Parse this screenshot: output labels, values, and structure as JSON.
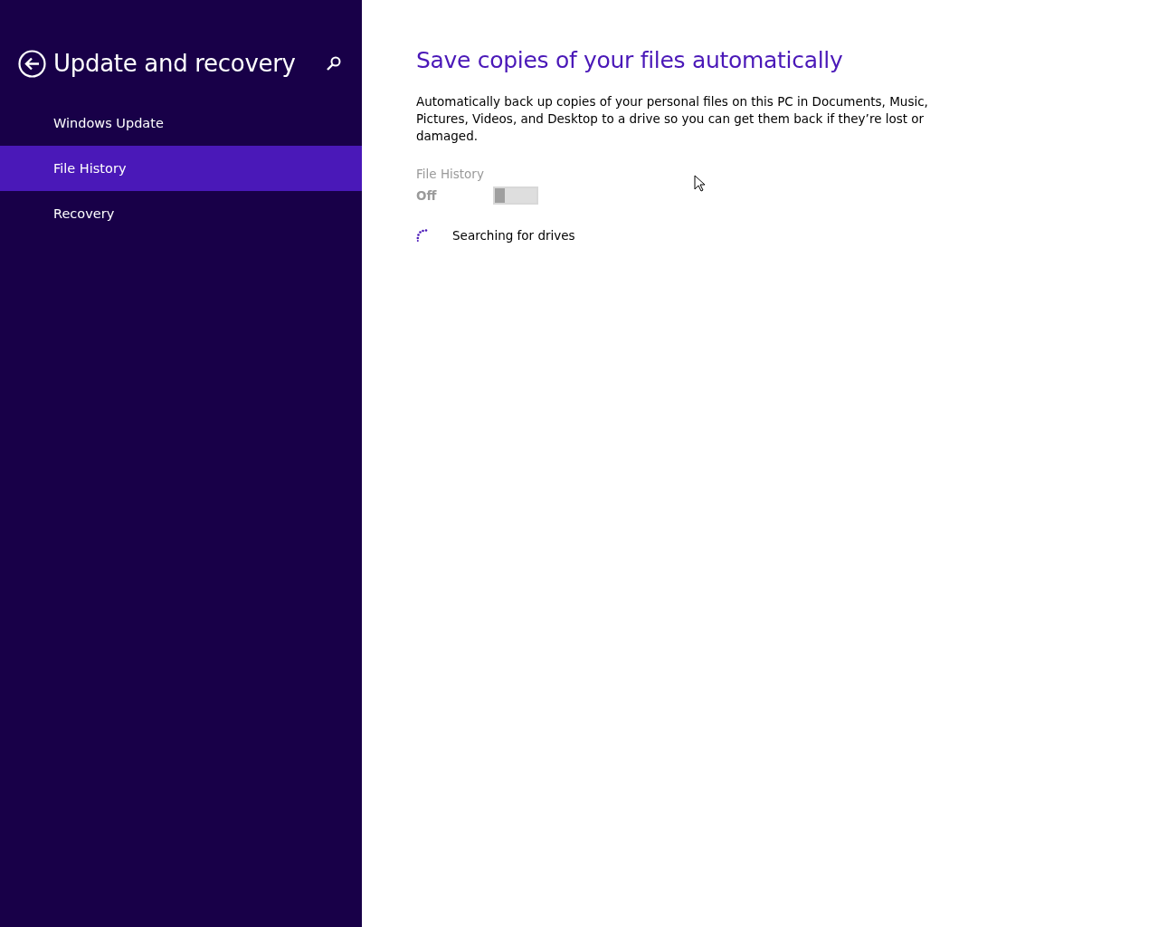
{
  "sidebar": {
    "title": "Update and recovery",
    "items": [
      {
        "label": "Windows Update",
        "selected": false
      },
      {
        "label": "File History",
        "selected": true
      },
      {
        "label": "Recovery",
        "selected": false
      }
    ]
  },
  "content": {
    "heading": "Save copies of your files automatically",
    "description": "Automatically back up copies of your personal files on this PC in Documents, Music, Pictures, Videos, and Desktop to a drive so you can get them back if they’re lost or damaged.",
    "toggle": {
      "label": "File History",
      "state_text": "Off",
      "on": false,
      "disabled": true
    },
    "status": {
      "text": "Searching for drives",
      "busy": true
    }
  }
}
